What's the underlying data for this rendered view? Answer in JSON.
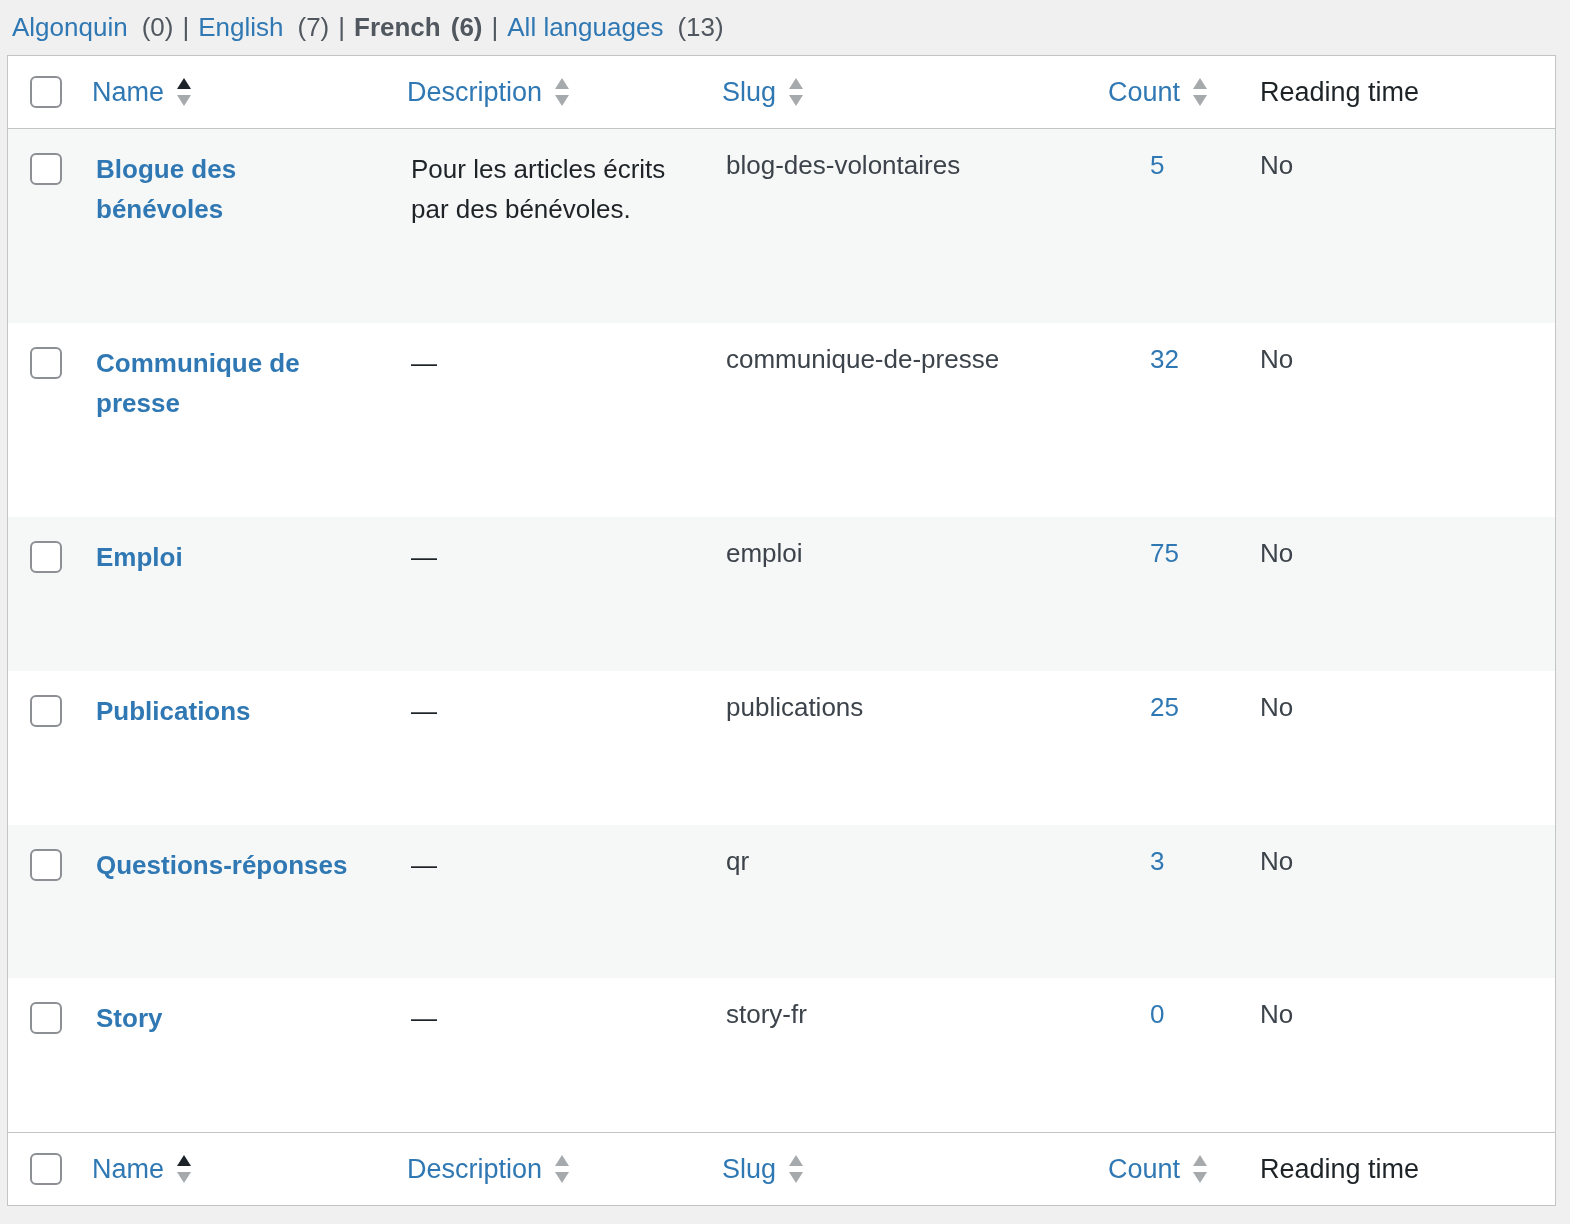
{
  "filters": [
    {
      "label": "Algonquin",
      "count": "(0)",
      "selected": false
    },
    {
      "separator": "|",
      "label": "English",
      "count": "(7)",
      "selected": false
    },
    {
      "separator": "|",
      "label": "French",
      "count": "(6)",
      "selected": true
    },
    {
      "separator": "|",
      "label": "All languages",
      "count": "(13)",
      "selected": false
    }
  ],
  "table": {
    "header_columns": [
      {
        "label": "Name",
        "sortable": true,
        "sorted": true
      },
      {
        "label": "Description",
        "sortable": true,
        "sorted": false
      },
      {
        "label": "Slug",
        "sortable": true,
        "sorted": false
      },
      {
        "label": "Count",
        "sortable": true,
        "sorted": false
      },
      {
        "label": "Reading time",
        "sortable": false
      }
    ],
    "select_all_checked": false,
    "rows": [
      {
        "checked": false,
        "name": "Blogue des bénévoles",
        "description": "Pour les articles écrits par des bénévoles.",
        "slug": "blog-des-volontaires",
        "count": "5",
        "reading_time": "No"
      },
      {
        "checked": false,
        "name": "Communique de presse",
        "description": "—",
        "slug": "communique-de-presse",
        "count": "32",
        "reading_time": "No"
      },
      {
        "checked": false,
        "name": "Emploi",
        "description": "—",
        "slug": "emploi",
        "count": "75",
        "reading_time": "No"
      },
      {
        "checked": false,
        "name": "Publications",
        "description": "—",
        "slug": "publications",
        "count": "25",
        "reading_time": "No"
      },
      {
        "checked": false,
        "name": "Questions-réponses",
        "description": "—",
        "slug": "qr",
        "count": "3",
        "reading_time": "No"
      },
      {
        "checked": false,
        "name": "Story",
        "description": "—",
        "slug": "story-fr",
        "count": "0",
        "reading_time": "No"
      }
    ],
    "footer_columns": [
      {
        "label": "Name",
        "sortable": true,
        "sorted": true
      },
      {
        "label": "Description",
        "sortable": true,
        "sorted": false
      },
      {
        "label": "Slug",
        "sortable": true,
        "sorted": false
      },
      {
        "label": "Count",
        "sortable": true,
        "sorted": false
      },
      {
        "label": "Reading time",
        "sortable": false
      }
    ],
    "footer_select_all_checked": false
  }
}
